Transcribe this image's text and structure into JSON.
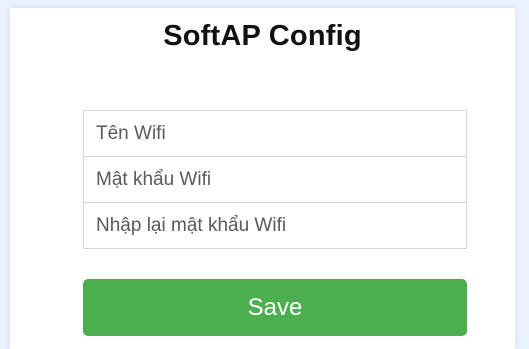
{
  "page": {
    "title": "SoftAP Config"
  },
  "form": {
    "wifi_name": {
      "value": "",
      "placeholder": "Tên Wifi"
    },
    "wifi_password": {
      "value": "",
      "placeholder": "Mật khẩu Wifi"
    },
    "wifi_password_confirm": {
      "value": "",
      "placeholder": "Nhập lại mật khẩu Wifi"
    },
    "save_label": "Save"
  },
  "colors": {
    "button_background": "#4cae4f",
    "button_text": "#ffffff",
    "page_background": "#ffffff",
    "outer_background": "#eaf2fb"
  }
}
